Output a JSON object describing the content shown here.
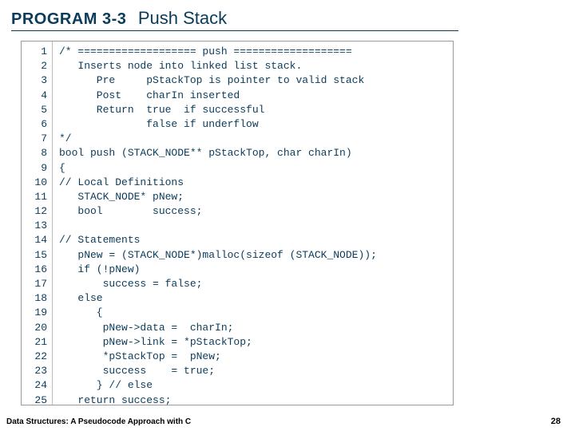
{
  "header": {
    "program_label": "PROGRAM 3-3",
    "program_title": "Push Stack"
  },
  "code": {
    "lines": [
      {
        "n": 1,
        "t": "/* =================== push ==================="
      },
      {
        "n": 2,
        "t": "   Inserts node into linked list stack."
      },
      {
        "n": 3,
        "t": "      Pre     pStackTop is pointer to valid stack"
      },
      {
        "n": 4,
        "t": "      Post    charIn inserted"
      },
      {
        "n": 5,
        "t": "      Return  true  if successful"
      },
      {
        "n": 6,
        "t": "              false if underflow"
      },
      {
        "n": 7,
        "t": "*/"
      },
      {
        "n": 8,
        "t": "bool push (STACK_NODE** pStackTop, char charIn)"
      },
      {
        "n": 9,
        "t": "{"
      },
      {
        "n": 10,
        "t": "// Local Definitions"
      },
      {
        "n": 11,
        "t": "   STACK_NODE* pNew;"
      },
      {
        "n": 12,
        "t": "   bool        success;"
      },
      {
        "n": 13,
        "t": ""
      },
      {
        "n": 14,
        "t": "// Statements"
      },
      {
        "n": 15,
        "t": "   pNew = (STACK_NODE*)malloc(sizeof (STACK_NODE));"
      },
      {
        "n": 16,
        "t": "   if (!pNew)"
      },
      {
        "n": 17,
        "t": "       success = false;"
      },
      {
        "n": 18,
        "t": "   else"
      },
      {
        "n": 19,
        "t": "      {"
      },
      {
        "n": 20,
        "t": "       pNew->data =  charIn;"
      },
      {
        "n": 21,
        "t": "       pNew->link = *pStackTop;"
      },
      {
        "n": 22,
        "t": "       *pStackTop =  pNew;"
      },
      {
        "n": 23,
        "t": "       success    = true;"
      },
      {
        "n": 24,
        "t": "      } // else"
      },
      {
        "n": 25,
        "t": "   return success;"
      }
    ]
  },
  "footer": {
    "left": "Data Structures: A Pseudocode Approach with C",
    "right": "28"
  }
}
